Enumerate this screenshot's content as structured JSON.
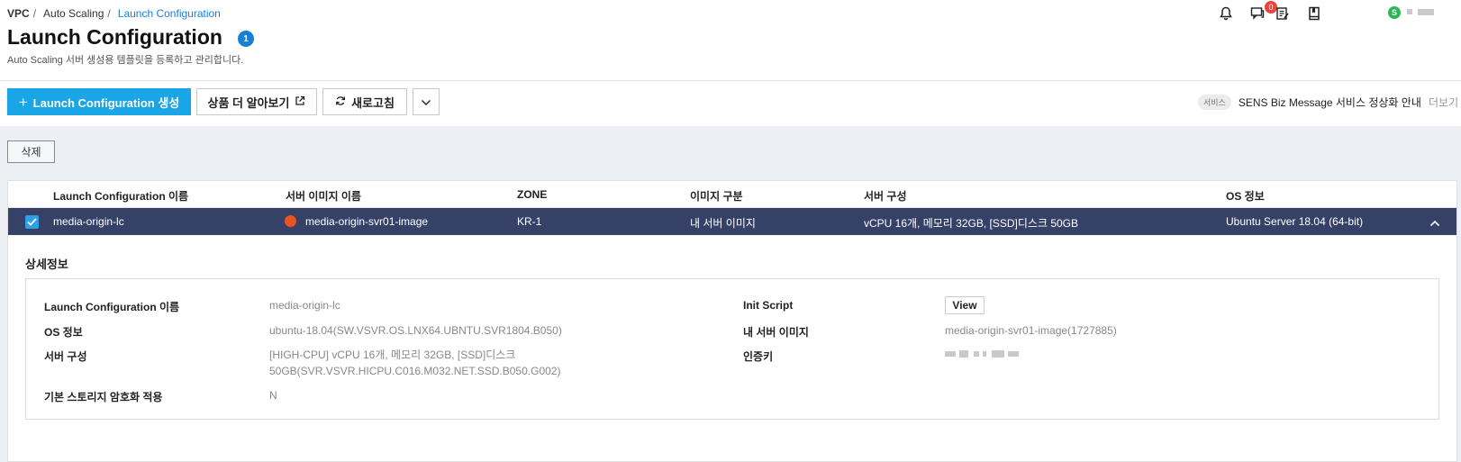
{
  "breadcrumb": {
    "items": [
      "VPC",
      "Auto Scaling",
      "Launch Configuration"
    ]
  },
  "page": {
    "title": "Launch Configuration",
    "count": "1",
    "subtitle": "Auto Scaling 서버 생성용 템플릿을 등록하고 관리합니다."
  },
  "header": {
    "notification_count": "0",
    "status_letter": "S"
  },
  "toolbar": {
    "create_label": "Launch Configuration 생성",
    "learn_more_label": "상품 더 알아보기",
    "refresh_label": "새로고침"
  },
  "notice": {
    "tag": "서비스",
    "text": "SENS Biz Message 서비스 정상화 안내",
    "more": "더보기"
  },
  "actions": {
    "delete_label": "삭제"
  },
  "table": {
    "columns": [
      "Launch Configuration 이름",
      "서버 이미지 이름",
      "ZONE",
      "이미지 구분",
      "서버 구성",
      "OS 정보"
    ],
    "rows": [
      {
        "name": "media-origin-lc",
        "image_name": "media-origin-svr01-image",
        "zone": "KR-1",
        "image_type": "내 서버 이미지",
        "spec": "vCPU 16개, 메모리 32GB, [SSD]디스크 50GB",
        "os": "Ubuntu Server 18.04 (64-bit)",
        "selected": true
      }
    ]
  },
  "detail": {
    "title": "상세정보",
    "labels": {
      "lc_name": "Launch Configuration 이름",
      "os_info": "OS 정보",
      "server_spec": "서버 구성",
      "encryption": "기본 스토리지 암호화 적용",
      "init_script": "Init Script",
      "my_image": "내 서버 이미지",
      "auth_key": "인증키"
    },
    "values": {
      "lc_name": "media-origin-lc",
      "os_info": "ubuntu-18.04(SW.VSVR.OS.LNX64.UBNTU.SVR1804.B050)",
      "server_spec_line1": "[HIGH-CPU] vCPU 16개, 메모리 32GB, [SSD]디스크",
      "server_spec_line2": "50GB(SVR.VSVR.HICPU.C016.M032.NET.SSD.B050.G002)",
      "encryption": "N",
      "init_script_button": "View",
      "my_image": "media-origin-svr01-image(1727885)"
    }
  },
  "colors": {
    "primary": "#19a5e6",
    "selected_row": "#364168",
    "link": "#1a7fd4",
    "badge_red": "#e8453c",
    "status_green": "#2cb653"
  }
}
